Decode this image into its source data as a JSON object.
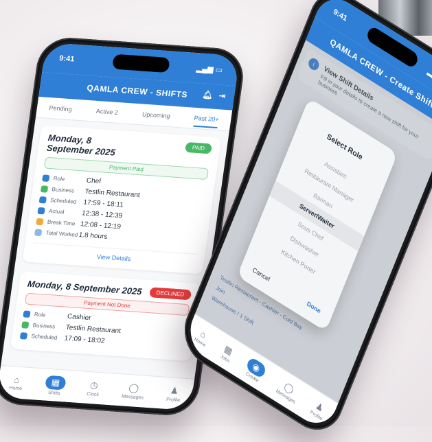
{
  "phone1": {
    "time": "9:41",
    "app_title": "QAMLA CREW - SHIFTS",
    "tabs": [
      "Pending",
      "Active 2",
      "Upcoming",
      "Past 20+"
    ],
    "cards": [
      {
        "date": "Monday, 8 September 2025",
        "badge": "PAID",
        "badge_color": "#49b866",
        "payment": "Payment Paid",
        "rows": [
          {
            "label": "Role",
            "value": "Chef",
            "icon_color": "#2f7fd6"
          },
          {
            "label": "Business",
            "value": "Testlin Restaurant",
            "icon_color": "#49b866"
          },
          {
            "label": "Scheduled",
            "value": "17:59 - 18:11",
            "icon_color": "#2f7fd6"
          },
          {
            "label": "Actual",
            "value": "12:38 - 12:39",
            "icon_color": "#2f7fd6"
          },
          {
            "label": "Break Time",
            "value": "12:08 - 12:19",
            "icon_color": "#f2a93b"
          },
          {
            "label": "Total Worked",
            "value": "1.8 hours",
            "icon_color": "#8ab8e8"
          }
        ],
        "link": "View Details"
      },
      {
        "date": "Monday, 8 September 2025",
        "badge": "DECLINED",
        "badge_color": "#e53b3b",
        "payment": "Payment Not Done",
        "rows": [
          {
            "label": "Role",
            "value": "Cashier",
            "icon_color": "#2f7fd6"
          },
          {
            "label": "Business",
            "value": "Testlin Restaurant",
            "icon_color": "#49b866"
          },
          {
            "label": "Scheduled",
            "value": "17:09 - 18:02",
            "icon_color": "#2f7fd6"
          }
        ]
      }
    ],
    "nav": [
      {
        "icon": "⌂",
        "label": "Home"
      },
      {
        "icon": "▦",
        "label": "Shifts"
      },
      {
        "icon": "◷",
        "label": "Clock"
      },
      {
        "icon": "◯",
        "label": "Messages"
      },
      {
        "icon": "♟",
        "label": "Profile"
      }
    ]
  },
  "phone2": {
    "time": "9:41",
    "app_title": "QAMLA CREW - Create Shift",
    "banner_title": "View Shift Details",
    "banner_sub": "Fill in your details to create a new shift for your business",
    "modal": {
      "title": "Select Role",
      "options": [
        "Assistant",
        "Restaurant Manager",
        "Barman",
        "Server/Waiter",
        "Sous Chef",
        "Dishwasher",
        "Kitchen Porter"
      ],
      "selected": "Server/Waiter",
      "cancel": "Cancel",
      "done": "Done"
    },
    "bg_lines": [
      "Testlin Restaurant - Cashier - Cold Bay",
      "Join",
      "Warehouse / 1 Shift"
    ],
    "nav": [
      {
        "icon": "⌂",
        "label": "Home"
      },
      {
        "icon": "▦",
        "label": "Jobs"
      },
      {
        "icon": "◉",
        "label": "Create"
      },
      {
        "icon": "◯",
        "label": "Messages"
      },
      {
        "icon": "♟",
        "label": "Profile"
      }
    ]
  }
}
